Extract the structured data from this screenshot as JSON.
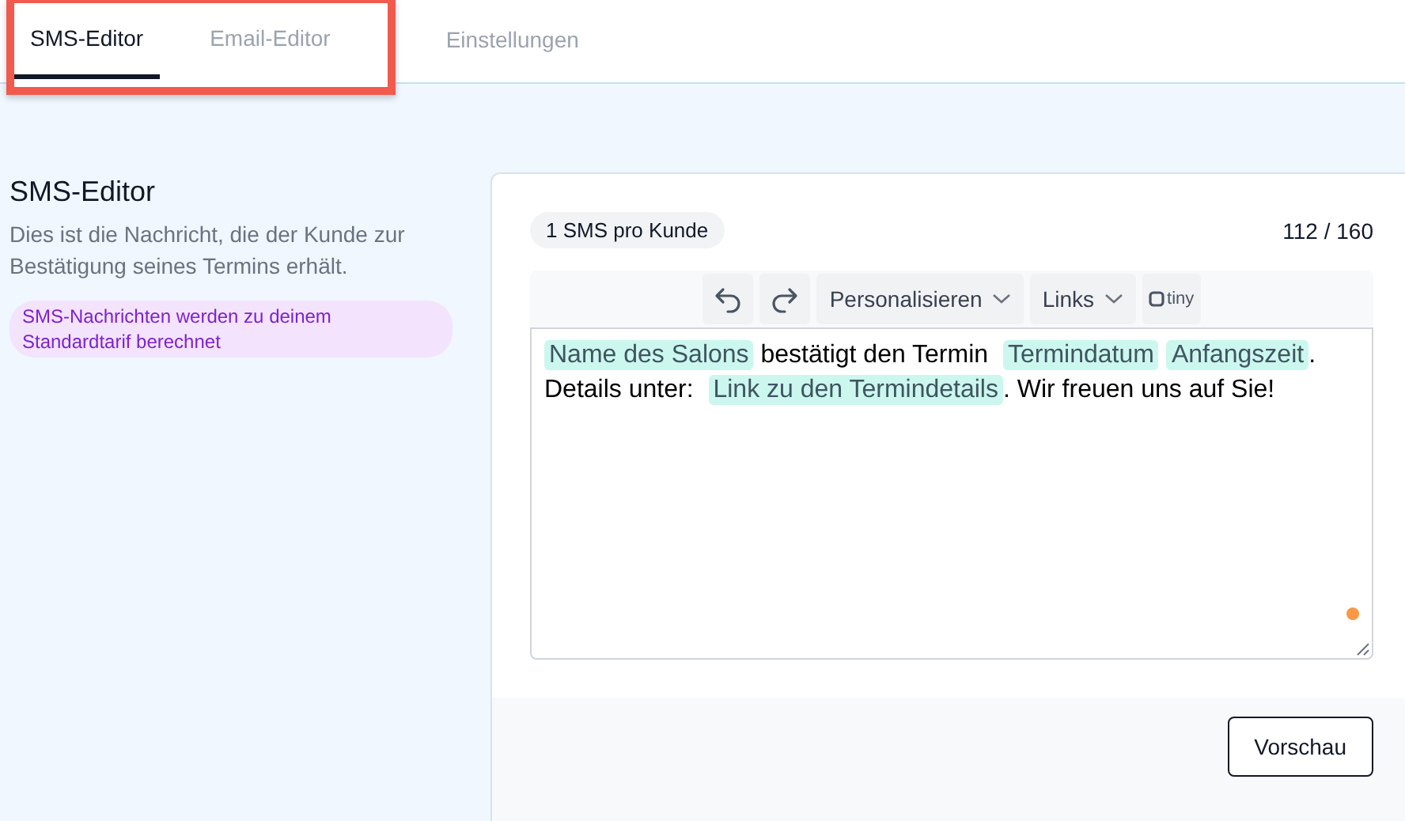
{
  "tabs": [
    {
      "label": "SMS-Editor",
      "selected": true,
      "highlighted": true
    },
    {
      "label": "Email-Editor",
      "selected": false,
      "highlighted": true
    },
    {
      "label": "Einstellungen",
      "selected": false,
      "highlighted": false
    }
  ],
  "intro": {
    "title": "SMS-Editor",
    "description": "Dies ist die Nachricht, die der Kunde zur Bestätigung seines Termins erhält.",
    "notice": "SMS-Nachrichten werden zu deinem Standardtarif berechnet"
  },
  "editor": {
    "badge": "1 SMS pro Kunde",
    "counter": "112 / 160",
    "toolbar": [
      {
        "kind": "undo"
      },
      {
        "kind": "redo"
      },
      {
        "kind": "menu",
        "label": "Personalisieren"
      },
      {
        "kind": "menu",
        "label": "Links"
      },
      {
        "kind": "brand",
        "label": "tiny"
      }
    ],
    "content": [
      {
        "kind": "tag",
        "text": "Name des Salons"
      },
      {
        "kind": "text",
        "text": " bestätigt den Termin "
      },
      {
        "kind": "tag",
        "text": "Termindatum"
      },
      {
        "kind": "tag",
        "text": "Anfangszeit"
      },
      {
        "kind": "text",
        "text": ". Details unter: "
      },
      {
        "kind": "tag",
        "text": "Link zu den Termindetails"
      },
      {
        "kind": "text",
        "text": ". Wir freuen uns auf Sie!"
      }
    ]
  },
  "footer": {
    "button": "Vorschau"
  }
}
